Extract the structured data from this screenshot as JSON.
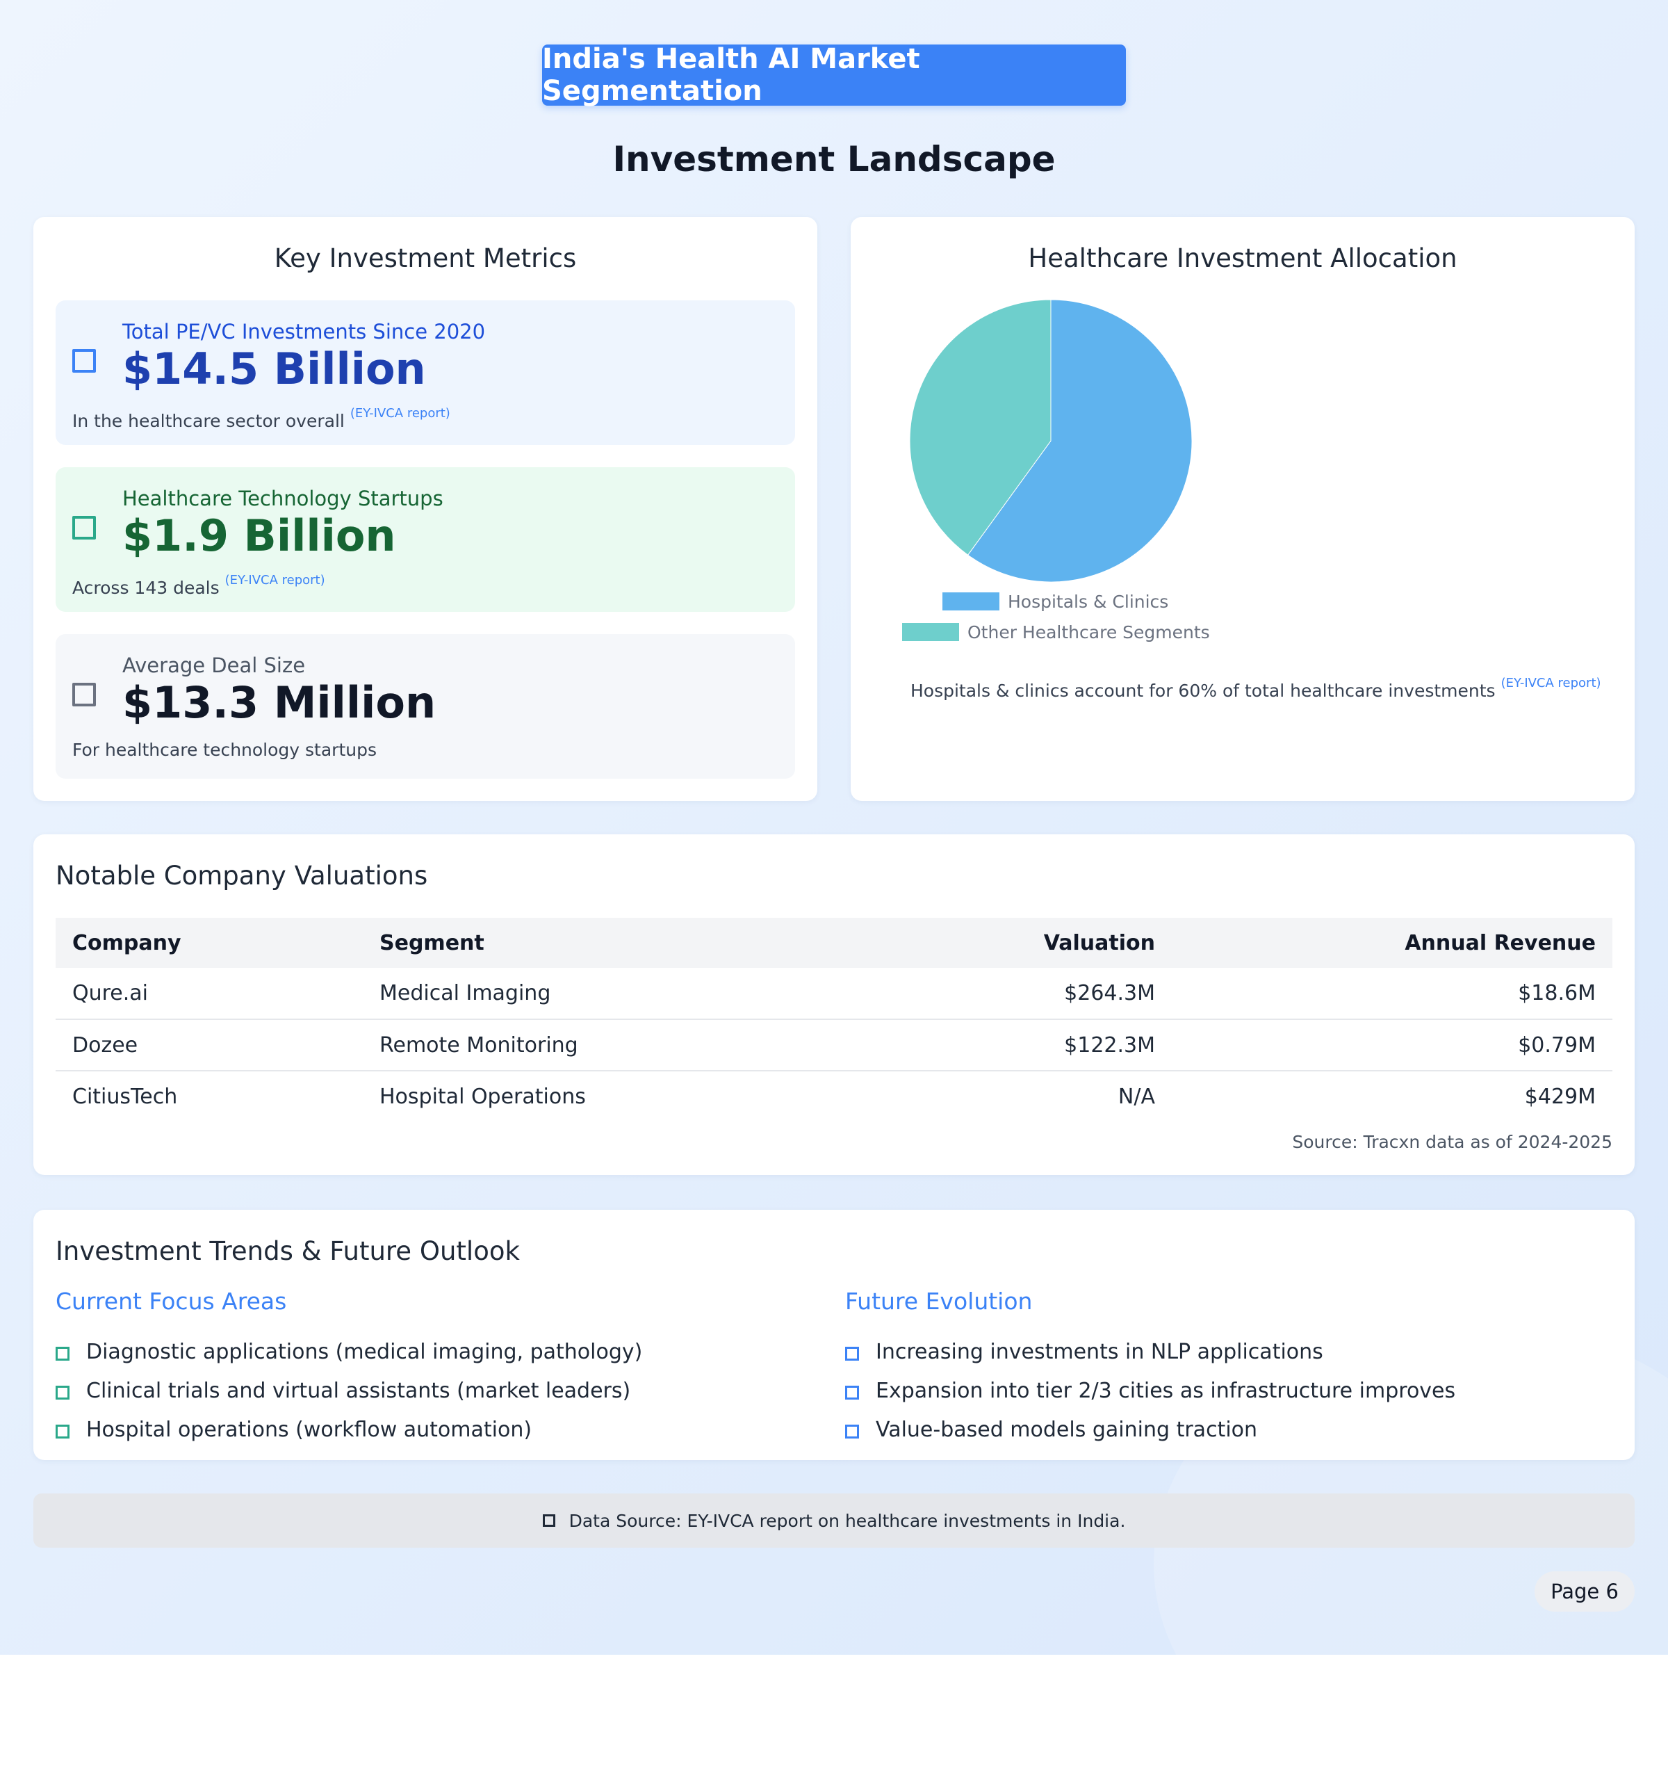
{
  "header": {
    "title": "India's Health AI Market Segmentation",
    "subtitle": "Investment Landscape"
  },
  "metrics_card": {
    "title": "Key Investment Metrics",
    "items": [
      {
        "label": "Total PE/VC Investments Since 2020",
        "value": "$14.5 Billion",
        "note": "In the healthcare sector overall",
        "cite": "(EY-IVCA report)",
        "icon": "square-outline-icon"
      },
      {
        "label": "Healthcare Technology Startups",
        "value": "$1.9 Billion",
        "note": "Across 143 deals",
        "cite": "(EY-IVCA report)",
        "icon": "square-outline-icon"
      },
      {
        "label": "Average Deal Size",
        "value": "$13.3 Million",
        "note": "For healthcare technology startups",
        "cite": "",
        "icon": "square-outline-icon"
      }
    ]
  },
  "allocation_card": {
    "title": "Healthcare Investment Allocation",
    "note": "Hospitals & clinics account for 60% of total healthcare investments",
    "cite": "(EY-IVCA report)"
  },
  "chart_data": {
    "type": "pie",
    "title": "",
    "labels": [
      "Hospitals & Clinics",
      "Other Healthcare Segments"
    ],
    "values": [
      60,
      40
    ],
    "colors": [
      "#5fb3ee",
      "#6ecfcc"
    ],
    "legend_position": "bottom"
  },
  "valuations_card": {
    "title": "Notable Company Valuations",
    "columns": [
      "Company",
      "Segment",
      "Valuation",
      "Annual Revenue"
    ],
    "rows": [
      [
        "Qure.ai",
        "Medical Imaging",
        "$264.3M",
        "$18.6M"
      ],
      [
        "Dozee",
        "Remote Monitoring",
        "$122.3M",
        "$0.79M"
      ],
      [
        "CitiusTech",
        "Hospital Operations",
        "N/A",
        "$429M"
      ]
    ],
    "source": "Source: Tracxn data as of 2024-2025"
  },
  "trends_card": {
    "title": "Investment Trends & Future Outlook",
    "current": {
      "heading": "Current Focus Areas",
      "items": [
        "Diagnostic applications (medical imaging, pathology)",
        "Clinical trials and virtual assistants (market leaders)",
        "Hospital operations (workflow automation)"
      ]
    },
    "future": {
      "heading": "Future Evolution",
      "items": [
        "Increasing investments in NLP applications",
        "Expansion into tier 2/3 cities as infrastructure improves",
        "Value-based models gaining traction"
      ]
    }
  },
  "footer": {
    "source": "Data Source: EY-IVCA report on healthcare investments in India.",
    "page": "Page 6"
  },
  "colors": {
    "accent": "#3b82f6",
    "green": "#2aa88a",
    "dark_green": "#166534"
  }
}
